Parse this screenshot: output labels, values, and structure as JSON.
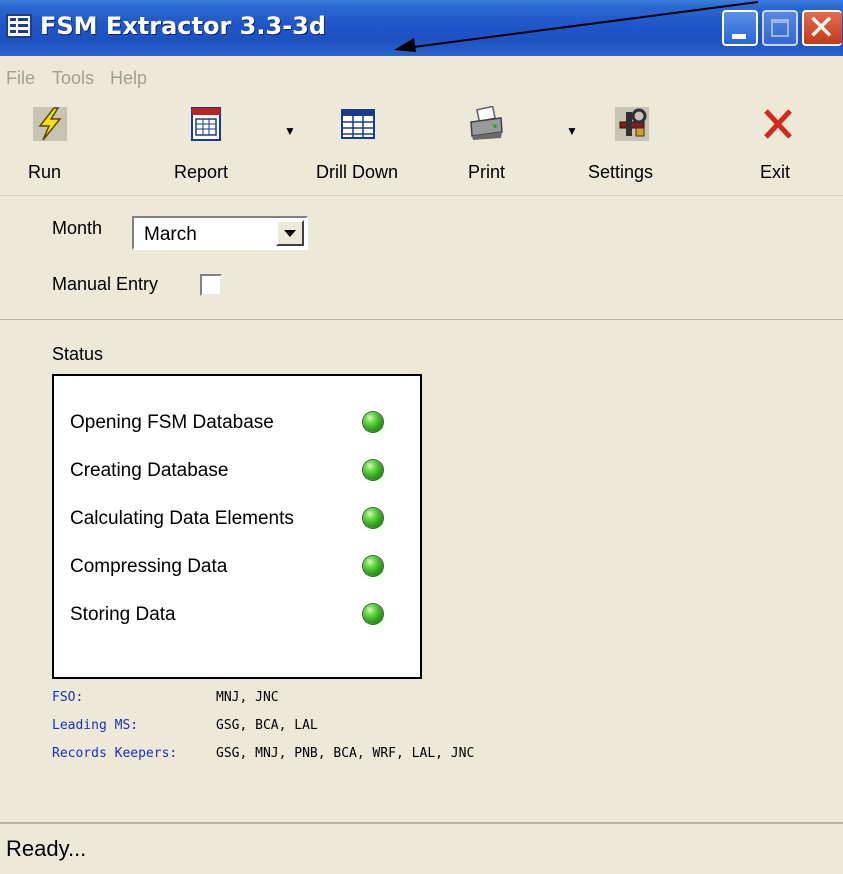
{
  "window": {
    "title": "FSM Extractor 3.3-3d"
  },
  "menu": {
    "items": [
      "File",
      "Tools",
      "Help"
    ]
  },
  "toolbar": {
    "items": [
      {
        "label": "Run",
        "icon": "lightning-icon"
      },
      {
        "label": "Report",
        "icon": "calendar-report-icon",
        "has_dropdown": true
      },
      {
        "label": "Drill Down",
        "icon": "table-grid-icon"
      },
      {
        "label": "Print",
        "icon": "printer-icon",
        "has_dropdown": true
      },
      {
        "label": "Settings",
        "icon": "tools-settings-icon"
      },
      {
        "label": "Exit",
        "icon": "red-x-icon"
      }
    ]
  },
  "form": {
    "month_label": "Month",
    "month_value": "March",
    "manual_entry_label": "Manual Entry",
    "manual_entry_checked": false
  },
  "status": {
    "heading": "Status",
    "items": [
      {
        "label": "Opening FSM Database",
        "state": "green"
      },
      {
        "label": "Creating Database",
        "state": "green"
      },
      {
        "label": "Calculating Data Elements",
        "state": "green"
      },
      {
        "label": "Compressing Data",
        "state": "green"
      },
      {
        "label": "Storing Data",
        "state": "green"
      }
    ]
  },
  "info": {
    "fso_label": "FSO:",
    "fso_value": "MNJ, JNC",
    "leading_ms_label": "Leading MS:",
    "leading_ms_value": "GSG, BCA, LAL",
    "records_keepers_label": "Records Keepers:",
    "records_keepers_value": "GSG, MNJ, PNB, BCA, WRF, LAL, JNC"
  },
  "statusbar": {
    "text": "Ready..."
  },
  "colors": {
    "titlebar": "#1f56c8",
    "info_label": "#1a2fbf",
    "status_led": "#2ea21a",
    "exit_x": "#d62718"
  }
}
